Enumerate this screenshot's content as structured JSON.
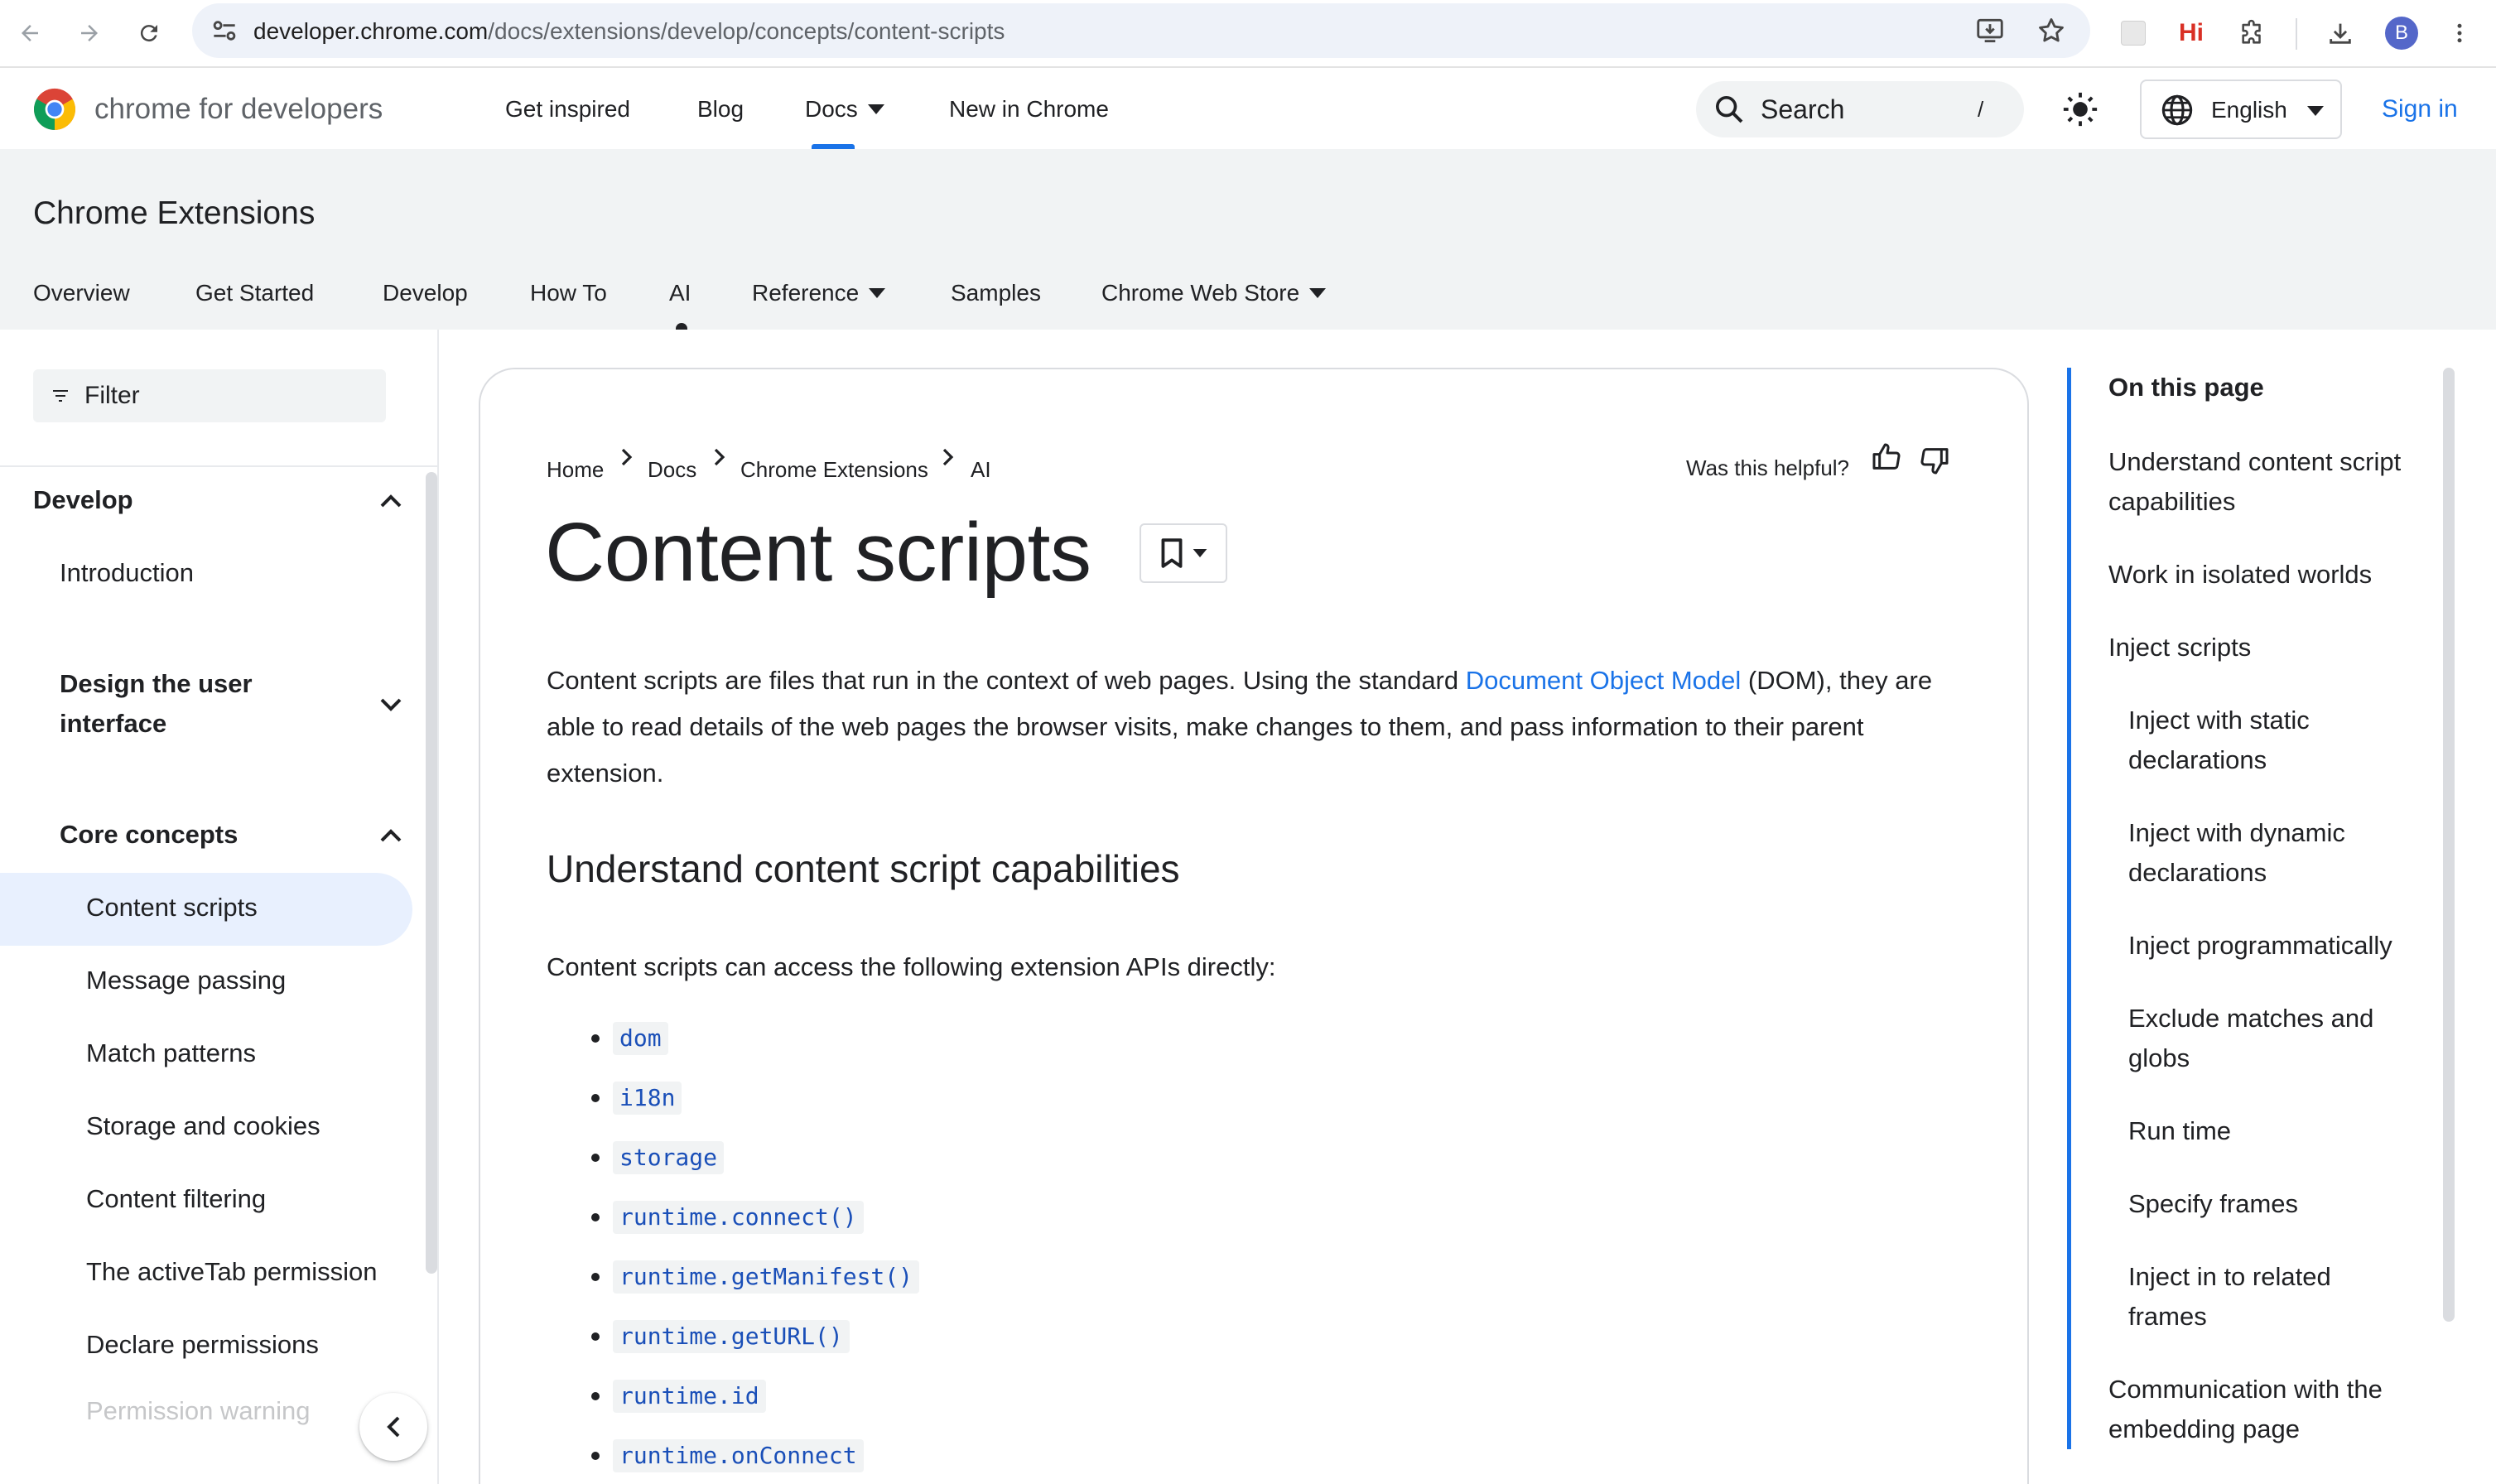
{
  "browser": {
    "url_host": "developer.chrome.com",
    "url_path": "/docs/extensions/develop/concepts/content-scripts",
    "profile_initial": "B",
    "extension_badge": "Hi",
    "icons": [
      "back-icon",
      "forward-icon",
      "reload-icon",
      "site-info-icon",
      "install-app-icon",
      "star-icon",
      "extension-puzzle-icon",
      "download-icon",
      "kebab-menu-icon"
    ]
  },
  "header": {
    "brand": "chrome for developers",
    "nav": [
      "Get inspired",
      "Blog",
      "Docs",
      "New in Chrome"
    ],
    "search_label": "Search",
    "search_shortcut": "/",
    "language": "English",
    "sign_in": "Sign in"
  },
  "section": {
    "title": "Chrome Extensions",
    "tabs": [
      "Overview",
      "Get Started",
      "Develop",
      "How To",
      "AI",
      "Reference",
      "Samples",
      "Chrome Web Store"
    ],
    "active_tab": "AI"
  },
  "sidebar": {
    "filter_label": "Filter",
    "develop": "Develop",
    "introduction": "Introduction",
    "design_ui": "Design the user interface",
    "core_concepts": "Core concepts",
    "items": [
      "Content scripts",
      "Message passing",
      "Match patterns",
      "Storage and cookies",
      "Content filtering",
      "The activeTab permission",
      "Declare permissions"
    ],
    "active_item": "Content scripts",
    "faded_item": "Permission warning"
  },
  "content": {
    "breadcrumbs": [
      "Home",
      "Docs",
      "Chrome Extensions",
      "AI"
    ],
    "helpful_label": "Was this helpful?",
    "title": "Content scripts",
    "intro_before_link": "Content scripts are files that run in the context of web pages. Using the standard ",
    "intro_link": "Document Object Model",
    "intro_after_link": " (DOM), they are able to read details of the web pages the browser visits, make changes to them, and pass information to their parent extension.",
    "heading": "Understand content script capabilities",
    "apis_intro": "Content scripts can access the following extension APIs directly:",
    "apis": [
      "dom",
      "i18n",
      "storage",
      "runtime.connect()",
      "runtime.getManifest()",
      "runtime.getURL()",
      "runtime.id",
      "runtime.onConnect"
    ]
  },
  "toc": {
    "title": "On this page",
    "items": [
      {
        "label": "Understand content script capabilities",
        "level": 1
      },
      {
        "label": "Work in isolated worlds",
        "level": 1
      },
      {
        "label": "Inject scripts",
        "level": 1
      },
      {
        "label": "Inject with static declarations",
        "level": 2
      },
      {
        "label": "Inject with dynamic declarations",
        "level": 2
      },
      {
        "label": "Inject programmatically",
        "level": 2
      },
      {
        "label": "Exclude matches and globs",
        "level": 2
      },
      {
        "label": "Run time",
        "level": 2
      },
      {
        "label": "Specify frames",
        "level": 2
      },
      {
        "label": "Inject in to related frames",
        "level": 2
      },
      {
        "label": "Communication with the embedding page",
        "level": 1
      }
    ]
  },
  "colors": {
    "accent": "#1a73e8",
    "active_bg": "#e8f0fe",
    "band_bg": "#f1f3f4",
    "code_text": "#1a4fb8"
  }
}
